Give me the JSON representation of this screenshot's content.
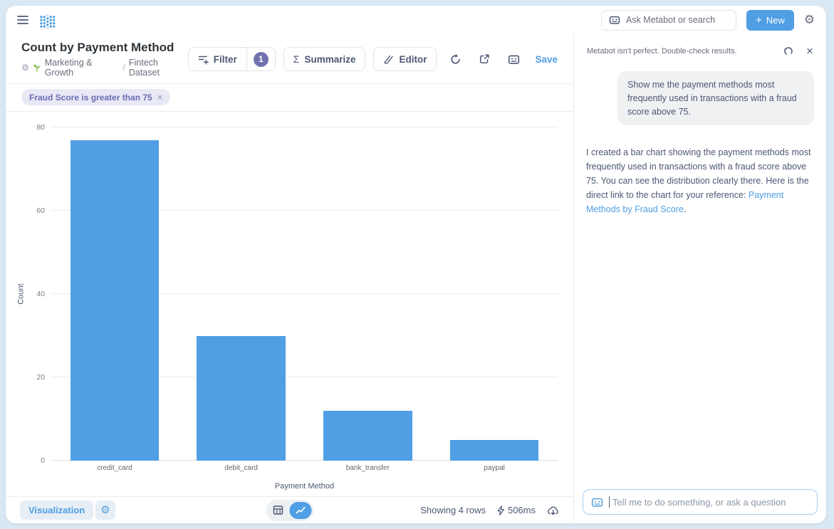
{
  "icons": {
    "gear": "⚙",
    "sigma": "Σ",
    "close": "×",
    "plus": "+"
  },
  "app_header": {
    "search_placeholder": "Ask Metabot or search",
    "new_label": "New"
  },
  "question": {
    "title": "Count by Payment Method",
    "breadcrumb": {
      "collection": "Marketing & Growth",
      "separator": "/",
      "dataset": "Fintech Dataset"
    },
    "toolbar": {
      "filter_label": "Filter",
      "filter_count": "1",
      "summarize_label": "Summarize",
      "editor_label": "Editor",
      "save_label": "Save"
    },
    "filters": [
      {
        "label": "Fraud Score is greater than 75"
      }
    ]
  },
  "chart_data": {
    "type": "bar",
    "categories": [
      "credit_card",
      "debit_card",
      "bank_transfer",
      "paypal"
    ],
    "values": [
      77,
      30,
      12,
      5
    ],
    "title": "Count by Payment Method",
    "xlabel": "Payment Method",
    "ylabel": "Count",
    "ylim": [
      0,
      80
    ],
    "yticks": [
      0,
      20,
      40,
      60,
      80
    ],
    "grid": true,
    "legend": "none",
    "bar_color": "#509EE3"
  },
  "footer": {
    "visualization_label": "Visualization",
    "showing_label": "Showing 4 rows",
    "duration_label": "506ms"
  },
  "metabot": {
    "disclaimer": "Metabot isn't perfect. Double-check results.",
    "user_message": "Show me the payment methods most frequently used in transactions with a fraud score above 75.",
    "reply_text": "I created a bar chart showing the payment methods most frequently used in transactions with a fraud score above 75. You can see the distribution clearly there. Here is the direct link to the chart for your reference: ",
    "reply_link": "Payment Methods by Fraud Score",
    "reply_end": ".",
    "input_placeholder": "Tell me to do something, or ask a question"
  },
  "colors": {
    "brand": "#509EE3",
    "filter_accent": "#7172AD",
    "chip_bg": "#e9e9f6"
  }
}
